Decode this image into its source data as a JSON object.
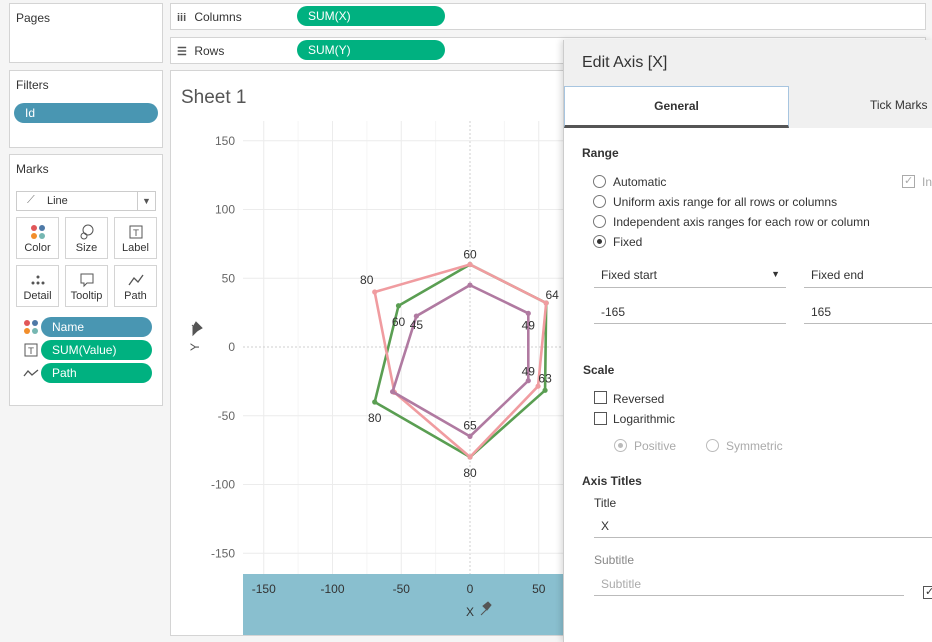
{
  "pages": {
    "title": "Pages"
  },
  "filters": {
    "title": "Filters",
    "pill": "Id"
  },
  "marks": {
    "title": "Marks",
    "mark_type": "Line",
    "buttons": [
      "Color",
      "Size",
      "Label",
      "Detail",
      "Tooltip",
      "Path"
    ],
    "fields": [
      {
        "label": "Name",
        "icon": "color-dots-icon"
      },
      {
        "label": "SUM(Value)",
        "icon": "label-t-icon"
      },
      {
        "label": "Path",
        "icon": "path-line-icon"
      }
    ]
  },
  "shelves": {
    "columns_label": "Columns",
    "columns_pill": "SUM(X)",
    "rows_label": "Rows",
    "rows_pill": "SUM(Y)"
  },
  "sheet": {
    "title": "Sheet 1"
  },
  "chart_data": {
    "type": "line",
    "xlabel": "X",
    "ylabel": "Y",
    "xlim": [
      -165,
      165
    ],
    "ylim": [
      -165,
      165
    ],
    "xticks": [
      -150,
      -100,
      -50,
      0,
      50
    ],
    "yticks": [
      150,
      100,
      50,
      0,
      -50,
      -100,
      -150
    ],
    "series": [
      {
        "color": "#5a9e52",
        "points": [
          [
            0,
            60
          ],
          [
            55.4,
            32
          ],
          [
            54.6,
            -31.5
          ],
          [
            0,
            -80
          ],
          [
            -69.3,
            -40
          ],
          [
            -52,
            30
          ]
        ],
        "labels": [
          "60",
          "64",
          "63",
          "80",
          "80",
          "60"
        ]
      },
      {
        "color": "#f09ca0",
        "points": [
          [
            0,
            60
          ],
          [
            55.4,
            32
          ],
          [
            49.5,
            -28.5
          ],
          [
            0,
            -80
          ],
          [
            -55,
            -33
          ],
          [
            -69.3,
            40
          ]
        ],
        "labels": [
          "",
          "",
          "",
          "",
          "",
          "80"
        ]
      },
      {
        "color": "#b07aa1",
        "points": [
          [
            0,
            45
          ],
          [
            42.4,
            24.5
          ],
          [
            42.4,
            -24.5
          ],
          [
            0,
            -65
          ],
          [
            -56.3,
            -32.5
          ],
          [
            -39,
            22.5
          ]
        ],
        "labels": [
          "",
          "49",
          "49",
          "65",
          "",
          "45"
        ]
      }
    ]
  },
  "dialog": {
    "title": "Edit Axis [X]",
    "tabs": [
      "General",
      "Tick Marks"
    ],
    "range_heading": "Range",
    "range_options": [
      "Automatic",
      "Uniform axis range for all rows or columns",
      "Independent axis ranges for each row or column",
      "Fixed"
    ],
    "include_zero_partial": "In",
    "fixed_start_label": "Fixed start",
    "fixed_end_label": "Fixed end",
    "fixed_start_value": "-165",
    "fixed_end_value": "165",
    "scale_heading": "Scale",
    "reversed_label": "Reversed",
    "logarithmic_label": "Logarithmic",
    "positive_label": "Positive",
    "symmetric_label": "Symmetric",
    "axis_titles_heading": "Axis Titles",
    "title_label": "Title",
    "title_value": "X",
    "subtitle_label": "Subtitle",
    "subtitle_placeholder": "Subtitle"
  }
}
